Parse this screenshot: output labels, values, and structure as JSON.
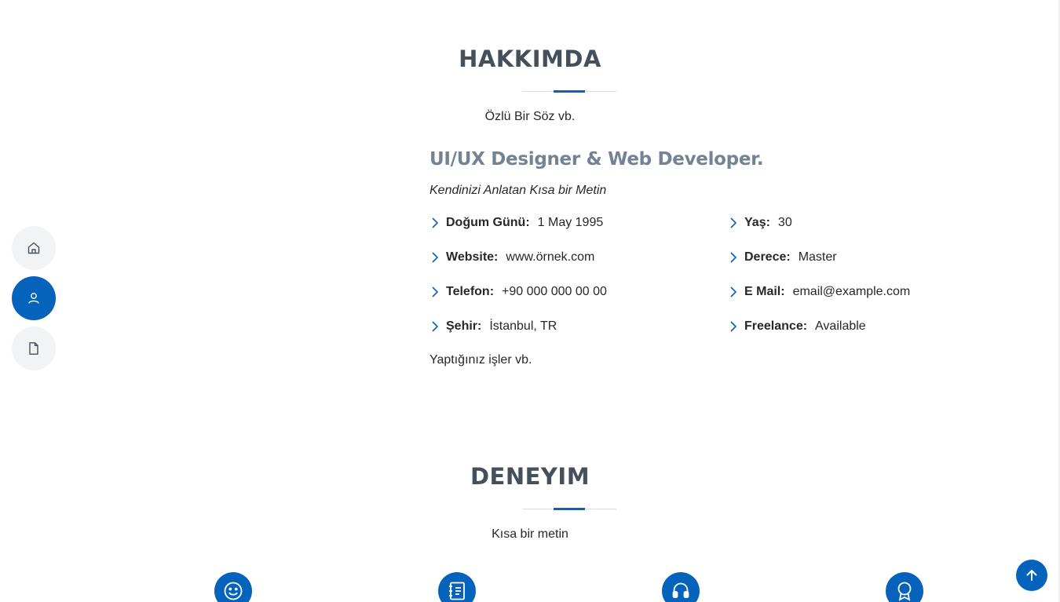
{
  "nav": {
    "items": [
      {
        "icon": "home-icon",
        "active": false
      },
      {
        "icon": "user-icon",
        "active": true
      },
      {
        "icon": "file-icon",
        "active": false
      }
    ]
  },
  "about": {
    "title": "HAKKIMDA",
    "subtitle": "Özlü Bir Söz vb.",
    "role": "UI/UX Designer & Web Developer.",
    "intro": "Kendinizi Anlatan Kısa bir Metin",
    "left_items": [
      {
        "label": "Doğum Günü:",
        "value": "1 May 1995"
      },
      {
        "label": "Website:",
        "value": "www.örnek.com"
      },
      {
        "label": "Telefon:",
        "value": "+90 000 000 00 00"
      },
      {
        "label": "Şehir:",
        "value": "İstanbul, TR"
      }
    ],
    "right_items": [
      {
        "label": "Yaş:",
        "value": "30"
      },
      {
        "label": "Derece:",
        "value": "Master"
      },
      {
        "label": "E Mail:",
        "value": "email@example.com"
      },
      {
        "label": "Freelance:",
        "value": "Available"
      }
    ],
    "work_text": "Yaptığınız işler vb."
  },
  "experience": {
    "title": "DENEYIM",
    "subtitle": "Kısa bir metin",
    "stat_icons": [
      "smile-icon",
      "journal-icon",
      "headset-icon",
      "award-icon"
    ]
  },
  "colors": {
    "accent": "#0563bb",
    "heading": "#45505b",
    "role": "#728394",
    "text": "#272829"
  }
}
